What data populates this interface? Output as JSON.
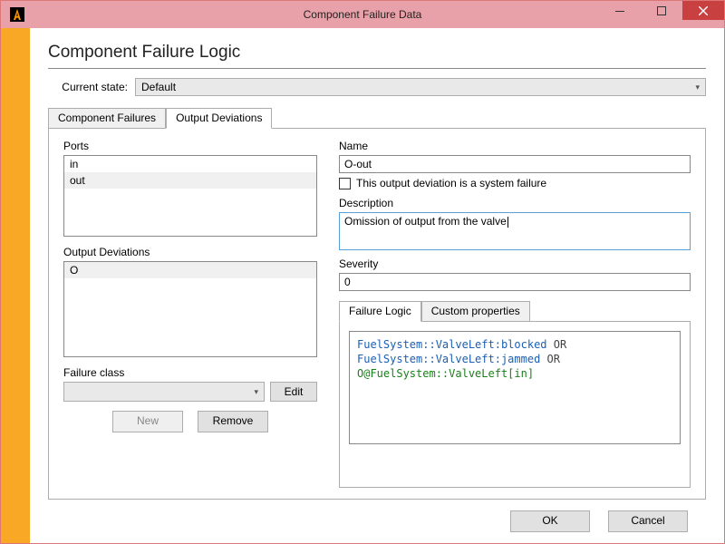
{
  "window": {
    "title": "Component Failure Data"
  },
  "page": {
    "title": "Component Failure Logic"
  },
  "state": {
    "label": "Current state:",
    "value": "Default"
  },
  "tabs": {
    "component_failures": "Component Failures",
    "output_deviations": "Output Deviations"
  },
  "ports": {
    "label": "Ports",
    "items": [
      "in",
      "out"
    ],
    "selected": 1
  },
  "deviations": {
    "label": "Output Deviations",
    "items": [
      "O"
    ],
    "selected": 0
  },
  "failure_class": {
    "label": "Failure class",
    "edit_btn": "Edit"
  },
  "buttons": {
    "new": "New",
    "remove": "Remove",
    "ok": "OK",
    "cancel": "Cancel"
  },
  "name": {
    "label": "Name",
    "value": "O-out"
  },
  "system_failure": {
    "label": "This output deviation is a system failure",
    "checked": false
  },
  "description": {
    "label": "Description",
    "value": "Omission of output from the valve"
  },
  "severity": {
    "label": "Severity",
    "value": "0"
  },
  "inner_tabs": {
    "failure_logic": "Failure Logic",
    "custom_properties": "Custom properties"
  },
  "logic": {
    "type1": "FuelSystem::ValveLeft:blocked",
    "type2": "FuelSystem::ValveLeft:jammed",
    "ref": "O@FuelSystem::ValveLeft[in]",
    "op": "OR"
  }
}
